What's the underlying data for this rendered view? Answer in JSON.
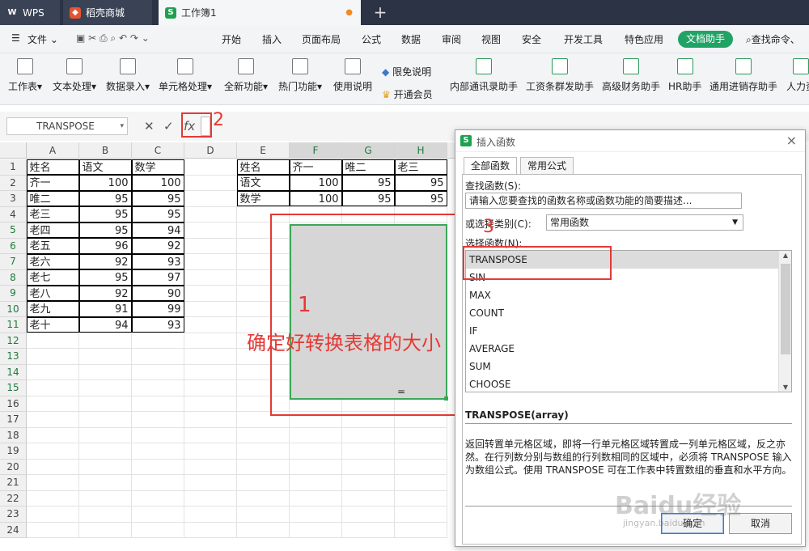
{
  "tabs": {
    "wps": "WPS",
    "store": "稻壳商城",
    "workbook": "工作簿1",
    "plus": "+"
  },
  "menubar": {
    "file": "文件",
    "items": [
      "开始",
      "插入",
      "页面布局",
      "公式",
      "数据",
      "审阅",
      "视图",
      "安全",
      "开发工具",
      "特色应用"
    ],
    "doc_helper": "文档助手",
    "search": "查找命令、"
  },
  "ribbon": {
    "buttons": [
      "工作表",
      "文本处理",
      "数据录入",
      "单元格处理",
      "全新功能",
      "热门功能",
      "使用说明"
    ],
    "limit_free": "限免说明",
    "vip": "开通会员",
    "right_buttons": [
      "内部通讯录助手",
      "工资条群发助手",
      "高级财务助手",
      "HR助手",
      "通用进销存助手",
      "人力资"
    ]
  },
  "formula_bar": {
    "name_box": "TRANSPOSE",
    "cancel": "✕",
    "confirm": "✓",
    "fx": "fx"
  },
  "annotations": {
    "one": "1",
    "two": "2",
    "three": "3",
    "caption": "确定好转换表格的大小"
  },
  "sheet": {
    "columns": [
      "A",
      "B",
      "C",
      "D",
      "E",
      "F",
      "G",
      "H"
    ],
    "rows": [
      "1",
      "2",
      "3",
      "4",
      "5",
      "6",
      "7",
      "8",
      "9",
      "10",
      "11",
      "12",
      "13",
      "14",
      "15",
      "16",
      "17",
      "18",
      "19",
      "20",
      "21",
      "22",
      "23",
      "24"
    ],
    "table1": [
      [
        "姓名",
        "语文",
        "数学"
      ],
      [
        "齐一",
        "100",
        "100"
      ],
      [
        "唯二",
        "95",
        "95"
      ],
      [
        "老三",
        "95",
        "95"
      ],
      [
        "老四",
        "95",
        "94"
      ],
      [
        "老五",
        "96",
        "92"
      ],
      [
        "老六",
        "92",
        "93"
      ],
      [
        "老七",
        "95",
        "97"
      ],
      [
        "老八",
        "92",
        "90"
      ],
      [
        "老九",
        "91",
        "99"
      ],
      [
        "老十",
        "94",
        "93"
      ]
    ],
    "table2": [
      [
        "姓名",
        "齐一",
        "唯二",
        "老三"
      ],
      [
        "语文",
        "100",
        "95",
        "95"
      ],
      [
        "数学",
        "100",
        "95",
        "95"
      ]
    ],
    "h15": "="
  },
  "dialog": {
    "title": "插入函数",
    "close": "×",
    "tab_all": "全部函数",
    "tab_common": "常用公式",
    "find_label": "查找函数(S):",
    "find_value": "请输入您要查找的函数名称或函数功能的简要描述...",
    "category_label": "或选择类别(C):",
    "category_value": "常用函数",
    "select_label": "选择函数(N):",
    "functions": [
      "TRANSPOSE",
      "SIN",
      "MAX",
      "COUNT",
      "IF",
      "AVERAGE",
      "SUM",
      "CHOOSE"
    ],
    "signature": "TRANSPOSE(array)",
    "description": "返回转置单元格区域，即将一行单元格区域转置成一列单元格区域，反之亦然。在行列数分别与数组的行列数相同的区域中，必须将 TRANSPOSE 输入为数组公式。使用 TRANSPOSE 可在工作表中转置数组的垂直和水平方向。",
    "ok": "确定",
    "cancel": "取消"
  },
  "watermark": {
    "brand": "Baidu经验",
    "url": "jingyan.baidu.com"
  }
}
